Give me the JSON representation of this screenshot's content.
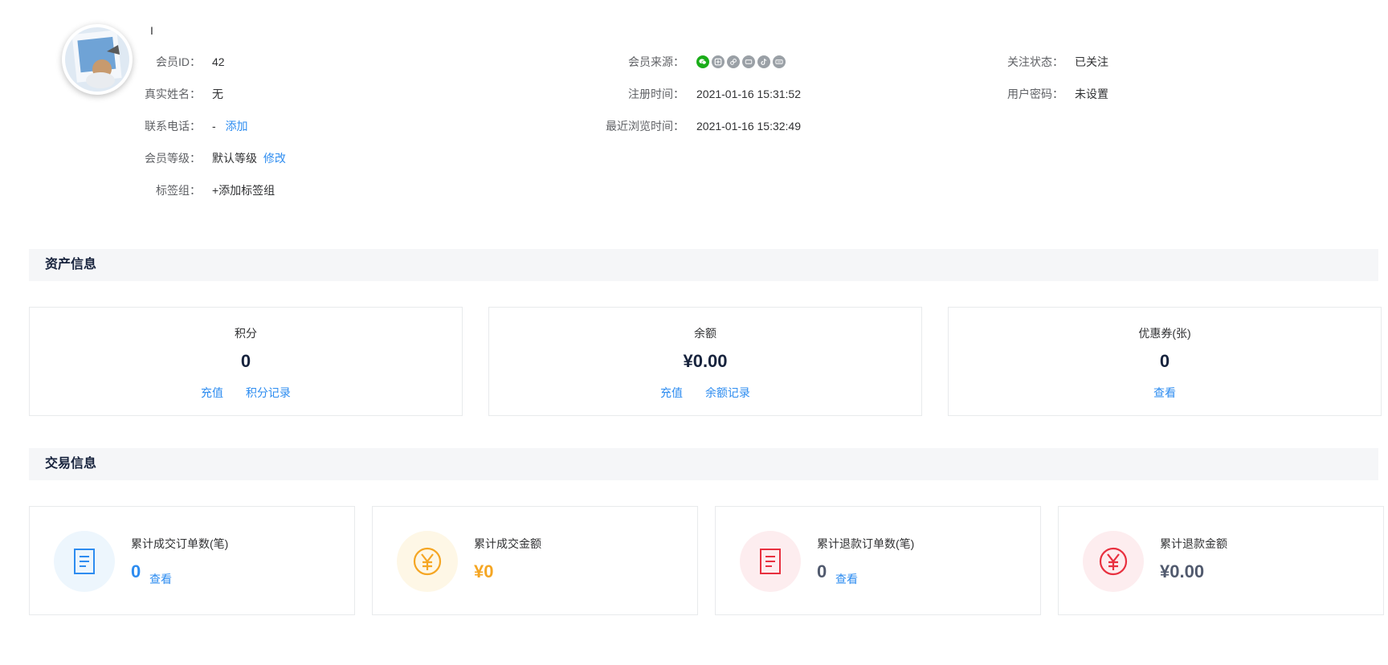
{
  "profile": {
    "nickname": "I",
    "member_id_label": "会员ID：",
    "member_id": "42",
    "real_name_label": "真实姓名：",
    "real_name": "无",
    "phone_label": "联系电话：",
    "phone": "-",
    "phone_add": "添加",
    "level_label": "会员等级：",
    "level": "默认等级",
    "level_edit": "修改",
    "tags_label": "标签组：",
    "tags_add": "+添加标签组",
    "source_label": "会员来源：",
    "source_icons": [
      "wechat-icon",
      "weibo-icon",
      "mini-program-icon",
      "toutiao-icon",
      "douyin-icon",
      "baidu-icon"
    ],
    "register_label": "注册时间：",
    "register_time": "2021-01-16 15:31:52",
    "browse_label": "最近浏览时间：",
    "browse_time": "2021-01-16 15:32:49",
    "follow_label": "关注状态：",
    "follow_status": "已关注",
    "password_label": "用户密码：",
    "password_status": "未设置"
  },
  "assets": {
    "title": "资产信息",
    "points": {
      "label": "积分",
      "value": "0",
      "link1": "充值",
      "link2": "积分记录"
    },
    "balance": {
      "label": "余额",
      "value": "¥0.00",
      "link1": "充值",
      "link2": "余额记录"
    },
    "coupons": {
      "label": "优惠券(张)",
      "value": "0",
      "link1": "查看"
    }
  },
  "trade": {
    "title": "交易信息",
    "orders": {
      "label": "累计成交订单数(笔)",
      "value": "0",
      "link": "查看",
      "color": "#2d8cf0",
      "bg": "#edf6fd"
    },
    "amount": {
      "label": "累计成交金额",
      "value": "¥0",
      "color": "#f5a623",
      "bg": "#fef7e6"
    },
    "refund_orders": {
      "label": "累计退款订单数(笔)",
      "value": "0",
      "link": "查看",
      "color": "#ed4014",
      "bg": "#fdedef"
    },
    "refund_amount": {
      "label": "累计退款金额",
      "value": "¥0.00",
      "color": "#e8303f",
      "bg": "#fdedef"
    }
  },
  "colors": {
    "accent": "#2d8cf0",
    "header_bg": "#f5f6f8",
    "border": "#e8eaec"
  }
}
